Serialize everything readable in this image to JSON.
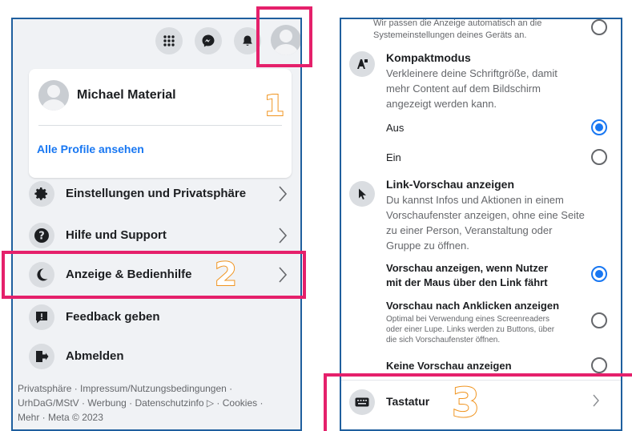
{
  "topbar": {
    "icons": [
      "apps-grid-icon",
      "messenger-icon",
      "bell-icon",
      "profile-avatar-icon"
    ]
  },
  "profile_card": {
    "name": "Michael Material",
    "all_profiles_link": "Alle Profile ansehen"
  },
  "menu": {
    "items": [
      {
        "label": "Einstellungen und Privatsphäre",
        "icon": "gear-icon"
      },
      {
        "label": "Hilfe und Support",
        "icon": "question-icon"
      },
      {
        "label": "Anzeige & Bedienhilfe",
        "icon": "moon-icon"
      },
      {
        "label": "Feedback geben",
        "icon": "feedback-icon"
      },
      {
        "label": "Abmelden",
        "icon": "logout-icon"
      }
    ]
  },
  "footer": {
    "line1": "Privatsphäre · Impressum/Nutzungsbedingungen ·",
    "line2": "UrhDaG/MStV · Werbung · Datenschutzinfo ▷ · Cookies ·",
    "line3": "Mehr · Meta © 2023"
  },
  "display_settings": {
    "top_partial_text_1": "Wir passen die Anzeige automatisch an die",
    "top_partial_text_2": "Systemeinstellungen deines Geräts an.",
    "compact_mode": {
      "title": "Kompaktmodus",
      "desc_1": "Verkleinere deine Schriftgröße, damit",
      "desc_2": "mehr Content auf dem Bildschirm",
      "desc_3": "angezeigt werden kann.",
      "option_off": "Aus",
      "option_on": "Ein",
      "selected": "Aus"
    },
    "link_preview": {
      "title": "Link-Vorschau anzeigen",
      "desc_1": "Du kannst Infos und Aktionen in einem",
      "desc_2": "Vorschaufenster anzeigen, ohne eine Seite",
      "desc_3": "zu einer Person, Veranstaltung oder",
      "desc_4": "Gruppe zu öffnen.",
      "option_hover_1": "Vorschau anzeigen, wenn Nutzer",
      "option_hover_2": "mit der Maus über den Link fährt",
      "option_click": "Vorschau nach Anklicken anzeigen",
      "option_click_desc_1": "Optimal bei Verwendung eines Screenreaders",
      "option_click_desc_2": "oder einer Lupe. Links werden zu Buttons, über",
      "option_click_desc_3": "die sich Vorschaufenster öffnen.",
      "option_none": "Keine Vorschau anzeigen",
      "selected": "Vorschau anzeigen, wenn Nutzer mit der Maus über den Link fährt"
    },
    "keyboard": {
      "label": "Tastatur",
      "icon": "keyboard-icon"
    }
  },
  "annotations": {
    "step1": "1",
    "step2": "2",
    "step3": "3",
    "highlight_color": "#e5206b",
    "number_color": "#f0941f"
  },
  "colors": {
    "accent": "#1877f2",
    "panel_border": "#1f5f9e"
  }
}
